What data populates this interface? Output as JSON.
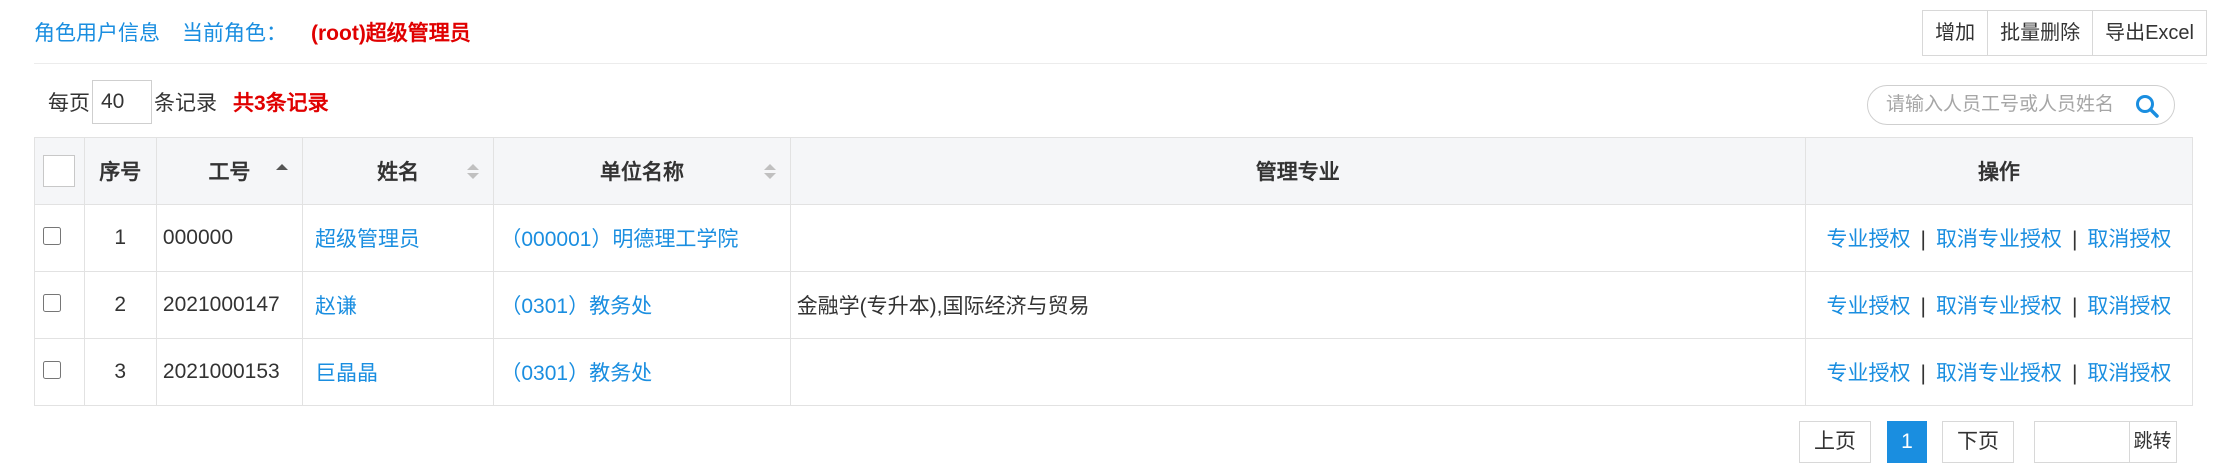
{
  "header": {
    "role_users_link": "角色用户信息",
    "current_role_label": "当前角色：",
    "current_role_value": "(root)超级管理员"
  },
  "toolbar": {
    "add_label": "增加",
    "batch_delete_label": "批量删除",
    "export_label": "导出Excel"
  },
  "paging_info": {
    "per_page_label": "每页",
    "per_page_value": "40",
    "records_label": "条记录",
    "total_text": "共3条记录"
  },
  "search": {
    "placeholder": "请输入人员工号或人员姓名",
    "icon": "search-icon"
  },
  "table": {
    "columns": [
      "",
      "序号",
      "工号",
      "姓名",
      "单位名称",
      "管理专业",
      "操作"
    ],
    "rows": [
      {
        "index": "1",
        "id": "000000",
        "name": "超级管理员",
        "unit": "（000001）明德理工学院",
        "majors": ""
      },
      {
        "index": "2",
        "id": "2021000147",
        "name": "赵谦",
        "unit": "（0301）教务处",
        "majors": "金融学(专升本),国际经济与贸易"
      },
      {
        "index": "3",
        "id": "2021000153",
        "name": "巨晶晶",
        "unit": "（0301）教务处",
        "majors": ""
      }
    ],
    "actions": {
      "grant": "专业授权",
      "revoke_major": "取消专业授权",
      "revoke": "取消授权",
      "separator": "|"
    }
  },
  "pagination": {
    "prev": "上页",
    "current": "1",
    "next": "下页",
    "jump_value": "",
    "jump_label": "跳转"
  },
  "colors": {
    "link": "#1a8ee0",
    "emphasis": "#e00000",
    "header_bg": "#f5f6f8"
  }
}
